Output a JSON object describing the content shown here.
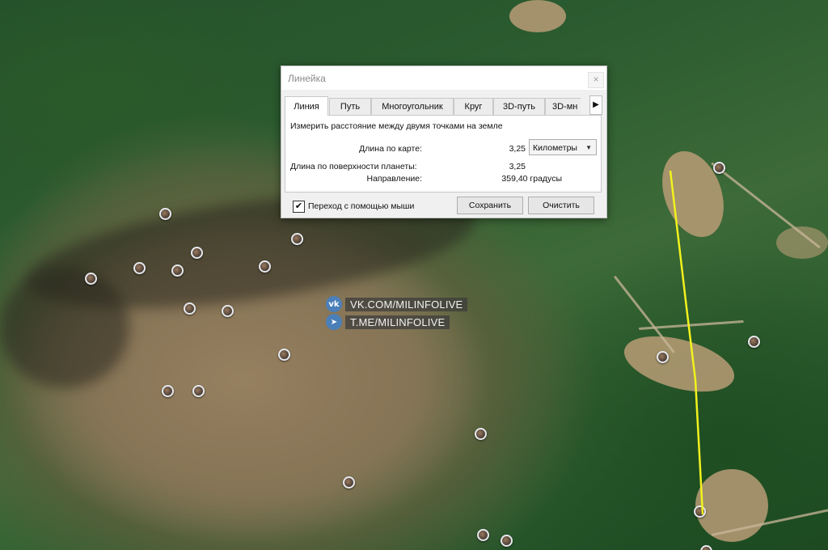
{
  "ruler_dialog": {
    "title": "Линейка",
    "close_label": "×",
    "tabs": [
      {
        "label": "Линия",
        "active": true
      },
      {
        "label": "Путь",
        "active": false
      },
      {
        "label": "Многоугольник",
        "active": false
      },
      {
        "label": "Круг",
        "active": false
      },
      {
        "label": "3D-путь",
        "active": false
      },
      {
        "label": "3D-мн",
        "active": false
      }
    ],
    "tab_scroll_icon": "triangle-right-icon",
    "description": "Измерить расстояние между двумя точками на земле",
    "map_length_label": "Длина по карте:",
    "map_length_value": "3,25",
    "unit_value": "Километры",
    "surface_length_label": "Длина по поверхности планеты:",
    "surface_length_value": "3,25",
    "direction_label": "Направление:",
    "direction_value": "359,40 градусы",
    "mouse_nav_checked": true,
    "mouse_nav_label": "Переход с помощью мыши",
    "save_label": "Сохранить",
    "clear_label": "Очистить"
  },
  "watermark": {
    "vk_icon_text": "vk",
    "vk_text": "VK.COM/MILINFOLIVE",
    "tg_icon_text": "➤",
    "tg_text": "T.ME/MILINFOLIVE"
  },
  "measure_line_color": "#f2f21e",
  "map_pins": {
    "count": 24,
    "icon": "photo-pin-icon"
  }
}
